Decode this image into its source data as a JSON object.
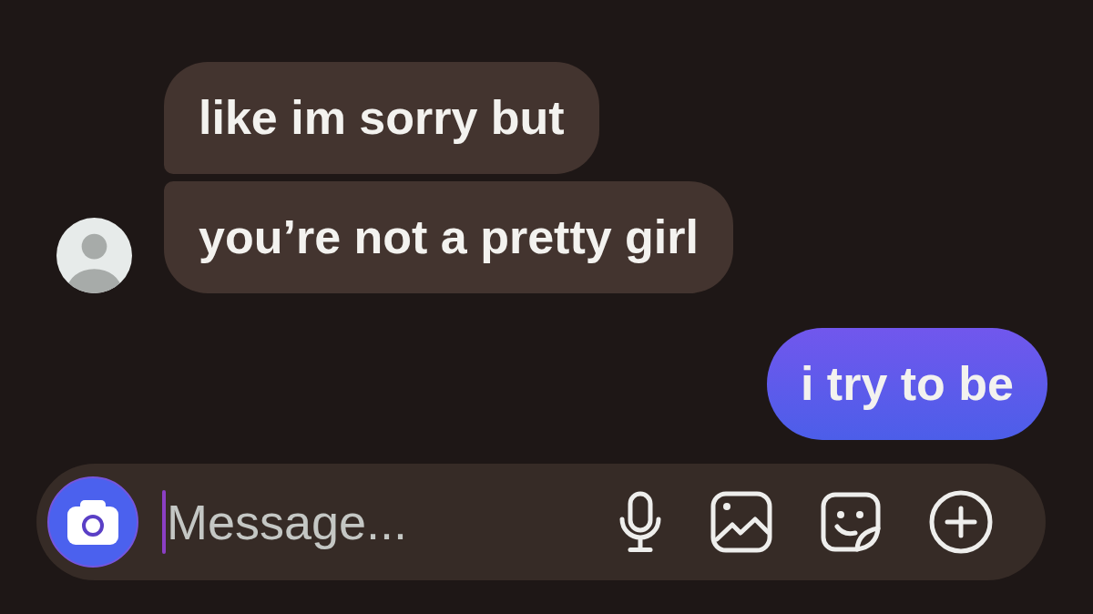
{
  "messages": [
    {
      "kind": "incoming",
      "text": "like im sorry but"
    },
    {
      "kind": "incoming",
      "text": "you’re not a pretty girl"
    },
    {
      "kind": "outgoing",
      "text": "i try to be"
    }
  ],
  "composer": {
    "placeholder": "Message...",
    "focused": true
  }
}
